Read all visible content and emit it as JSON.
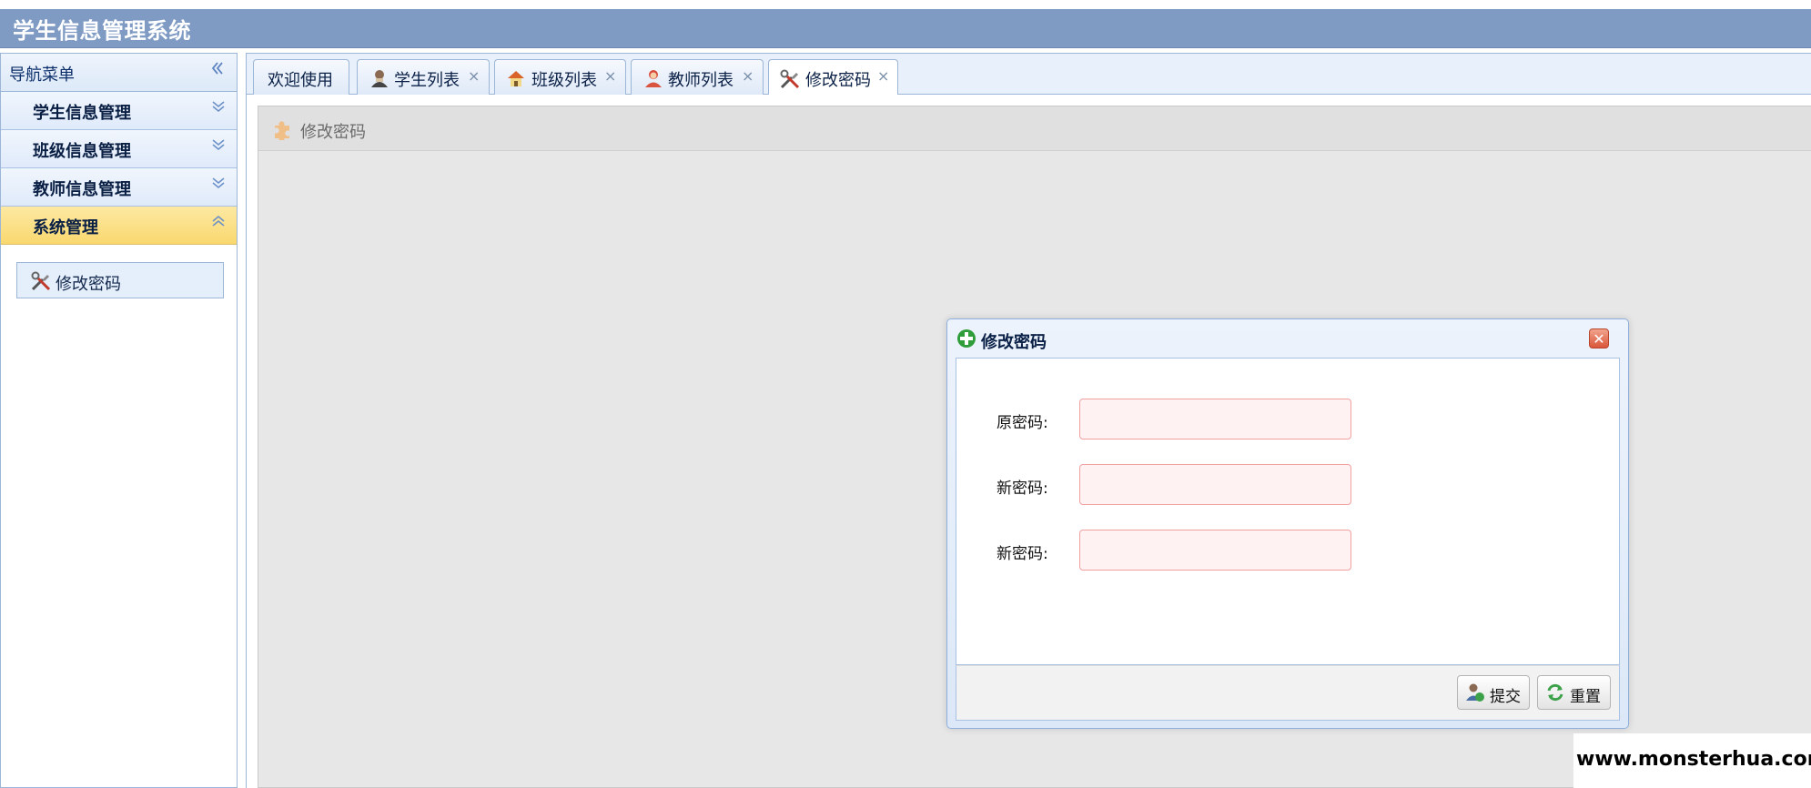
{
  "app": {
    "title": "学生信息管理系统"
  },
  "sidebar": {
    "header": "导航菜单",
    "items": [
      {
        "label": "学生信息管理",
        "expanded": false
      },
      {
        "label": "班级信息管理",
        "expanded": false
      },
      {
        "label": "教师信息管理",
        "expanded": false
      },
      {
        "label": "系统管理",
        "expanded": true
      }
    ],
    "sub_items": [
      {
        "label": "修改密码",
        "icon": "tools-icon"
      }
    ]
  },
  "tabs": [
    {
      "label": "欢迎使用",
      "closable": false
    },
    {
      "label": "学生列表",
      "icon": "student-icon",
      "closable": true
    },
    {
      "label": "班级列表",
      "icon": "house-icon",
      "closable": true
    },
    {
      "label": "教师列表",
      "icon": "teacher-icon",
      "closable": true
    },
    {
      "label": "修改密码",
      "icon": "tools-icon",
      "closable": true,
      "selected": true
    }
  ],
  "panel": {
    "title": "修改密码"
  },
  "dialog": {
    "title": "修改密码",
    "fields": [
      {
        "label": "原密码:",
        "value": ""
      },
      {
        "label": "新密码:",
        "value": ""
      },
      {
        "label": "新密码:",
        "value": ""
      }
    ],
    "buttons": {
      "submit": "提交",
      "reset": "重置"
    }
  },
  "watermark": "www.monsterhua.com",
  "colors": {
    "header": "#7f9bc4",
    "active_menu": "#f9d86f",
    "input_invalid": "#fff2f2"
  },
  "symbols": {
    "collapse": "«",
    "expand": "»",
    "close": "×",
    "dialog_close": "✕"
  }
}
